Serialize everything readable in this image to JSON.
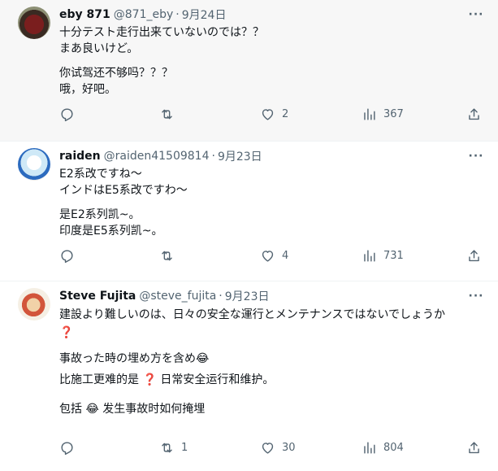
{
  "tweets": [
    {
      "name": "eby 871",
      "handle": "@871_eby",
      "date": "9月24日",
      "lines": [
        "十分テスト走行出来ていないのでは？？",
        "まあ良いけど。",
        "",
        "你试驾还不够吗？？？",
        "哦，好吧。"
      ],
      "replies": "",
      "retweets": "",
      "likes": "2",
      "views": "367"
    },
    {
      "name": "raiden",
      "handle": "@raiden41509814",
      "date": "9月23日",
      "lines": [
        "E2系改ですね〜",
        "インドはE5系改ですわ〜",
        "",
        "是E2系列凯~。",
        "印度是E5系列凯~。"
      ],
      "replies": "",
      "retweets": "",
      "likes": "4",
      "views": "731"
    },
    {
      "name": "Steve Fujita",
      "handle": "@steve_fujita",
      "date": "9月23日",
      "line1": "建設より難しいのは、日々の安全な運行とメンテナンスではないでしょうか",
      "q1": "❓",
      "line2": "事故った時の埋め方を含め😂",
      "line3a": "比施工更难的是",
      "q2": "❓",
      "line3b": "日常安全运行和维护。",
      "line4a": "包括",
      "emoji": "😂",
      "line4b": "发生事故时如何掩埋",
      "replies": "",
      "retweets": "1",
      "likes": "30",
      "views": "804"
    }
  ],
  "icons": {
    "more": "more-icon",
    "reply": "reply-icon",
    "retweet": "retweet-icon",
    "like": "like-icon",
    "views": "views-icon",
    "share": "share-icon"
  }
}
